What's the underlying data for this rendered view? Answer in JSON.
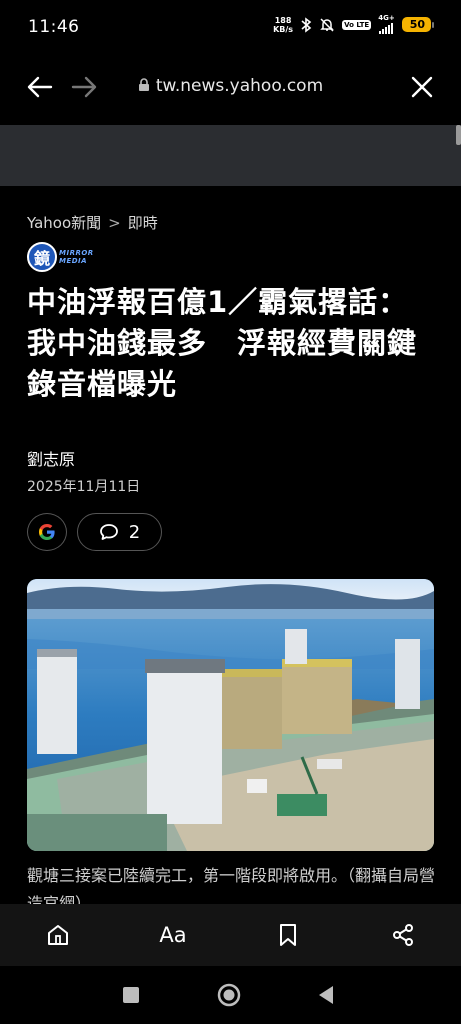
{
  "status_bar": {
    "time": "11:46",
    "net_speed_value": "188",
    "net_speed_unit": "KB/s",
    "volte": "Vo LTE",
    "network": "4G+",
    "battery": "50",
    "icons": [
      "bluetooth-icon",
      "mute-icon",
      "signal-icon"
    ]
  },
  "browser": {
    "url": "tw.news.yahoo.com"
  },
  "article": {
    "breadcrumb": [
      "Yahoo新聞",
      "即時"
    ],
    "source_logo_glyph": "鏡",
    "source_logo_text": [
      "MIRROR",
      "MEDIA"
    ],
    "headline": "中油浮報百億1／霸氣撂話：我中油錢最多　浮報經費關鍵錄音檔曝光",
    "author": "劉志原",
    "date": "2025年11月11日",
    "comment_count": "2",
    "caption": "觀塘三接案已陸續完工，第一階段即將啟用。（翻攝自局營造官網）"
  },
  "bottom_toolbar": {
    "text_size_label": "Aa"
  },
  "colors": {
    "background": "#000000",
    "banner": "#2b2d31",
    "battery": "#f5b301",
    "bottom_bar": "#141414"
  }
}
